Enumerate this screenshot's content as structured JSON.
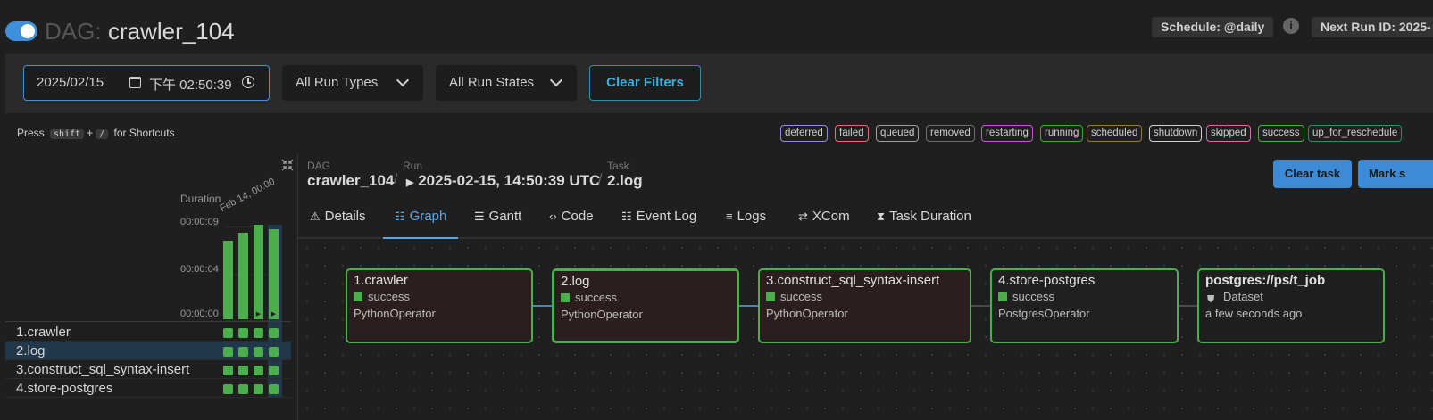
{
  "header": {
    "dag_label": "DAG:",
    "dag_id": "crawler_104",
    "schedule": "Schedule: @daily",
    "next_run": "Next Run ID: 2025-"
  },
  "filters": {
    "date_value": "2025/02/15",
    "time_value": "下午 02:50:39",
    "run_types": "All Run Types",
    "run_states": "All Run States",
    "clear_filters": "Clear Filters"
  },
  "shortcuts": {
    "press": "Press",
    "key1": "shift",
    "plus": "+",
    "key2": "/",
    "suffix": "for Shortcuts"
  },
  "legend": [
    {
      "label": "deferred",
      "color": "#9a8ad9"
    },
    {
      "label": "failed",
      "color": "#e07070"
    },
    {
      "label": "queued",
      "color": "#9e9e9e"
    },
    {
      "label": "removed",
      "color": "#6e6e6e"
    },
    {
      "label": "restarting",
      "color": "#c05ad0"
    },
    {
      "label": "running",
      "color": "#38a83a"
    },
    {
      "label": "scheduled",
      "color": "#a0733a"
    },
    {
      "label": "shutdown",
      "color": "#cfcfcf"
    },
    {
      "label": "skipped",
      "color": "#d46cb0"
    },
    {
      "label": "success",
      "color": "#4cae4c"
    },
    {
      "label": "up_for_reschedule",
      "color": "#2e8a6a"
    }
  ],
  "grid": {
    "duration_label": "Duration",
    "run_date_label": "Feb 14, 00:00",
    "ticks": [
      "00:00:09",
      "00:00:04",
      "00:00:00"
    ],
    "runs_duration_fraction": [
      0.8,
      0.88,
      0.96,
      0.92
    ],
    "tasks": [
      {
        "label": "1.crawler"
      },
      {
        "label": "2.log"
      },
      {
        "label": "3.construct_sql_syntax-insert"
      },
      {
        "label": "4.store-postgres"
      }
    ],
    "selected_task_index": 1,
    "selected_run_index": 3
  },
  "breadcrumb": {
    "dag_key": "DAG",
    "dag_value": "crawler_104",
    "run_key": "Run",
    "run_value": "2025-02-15, 14:50:39 UTC",
    "task_key": "Task",
    "task_value": "2.log"
  },
  "actions": {
    "clear_task": "Clear task",
    "mark": "Mark s"
  },
  "tabs": [
    {
      "label": "Details",
      "icon": "warning-icon"
    },
    {
      "label": "Graph",
      "icon": "graph-icon"
    },
    {
      "label": "Gantt",
      "icon": "gantt-icon"
    },
    {
      "label": "Code",
      "icon": "code-icon"
    },
    {
      "label": "Event Log",
      "icon": "calendar-icon"
    },
    {
      "label": "Logs",
      "icon": "list-icon"
    },
    {
      "label": "XCom",
      "icon": "arrows-icon"
    },
    {
      "label": "Task Duration",
      "icon": "hourglass-icon"
    }
  ],
  "active_tab": "Graph",
  "graph": {
    "nodes": [
      {
        "title": "1.crawler",
        "status": "success",
        "operator": "PythonOperator"
      },
      {
        "title": "2.log",
        "status": "success",
        "operator": "PythonOperator"
      },
      {
        "title": "3.construct_sql_syntax-insert",
        "status": "success",
        "operator": "PythonOperator"
      },
      {
        "title": "4.store-postgres",
        "status": "success",
        "operator": "PostgresOperator"
      },
      {
        "title": "postgres://ps/t_job",
        "kind": "Dataset",
        "updated": "a few seconds ago"
      }
    ]
  },
  "colors": {
    "accent": "#3d8bd4",
    "success": "#4cae4c",
    "edge": "#4f82ad"
  }
}
